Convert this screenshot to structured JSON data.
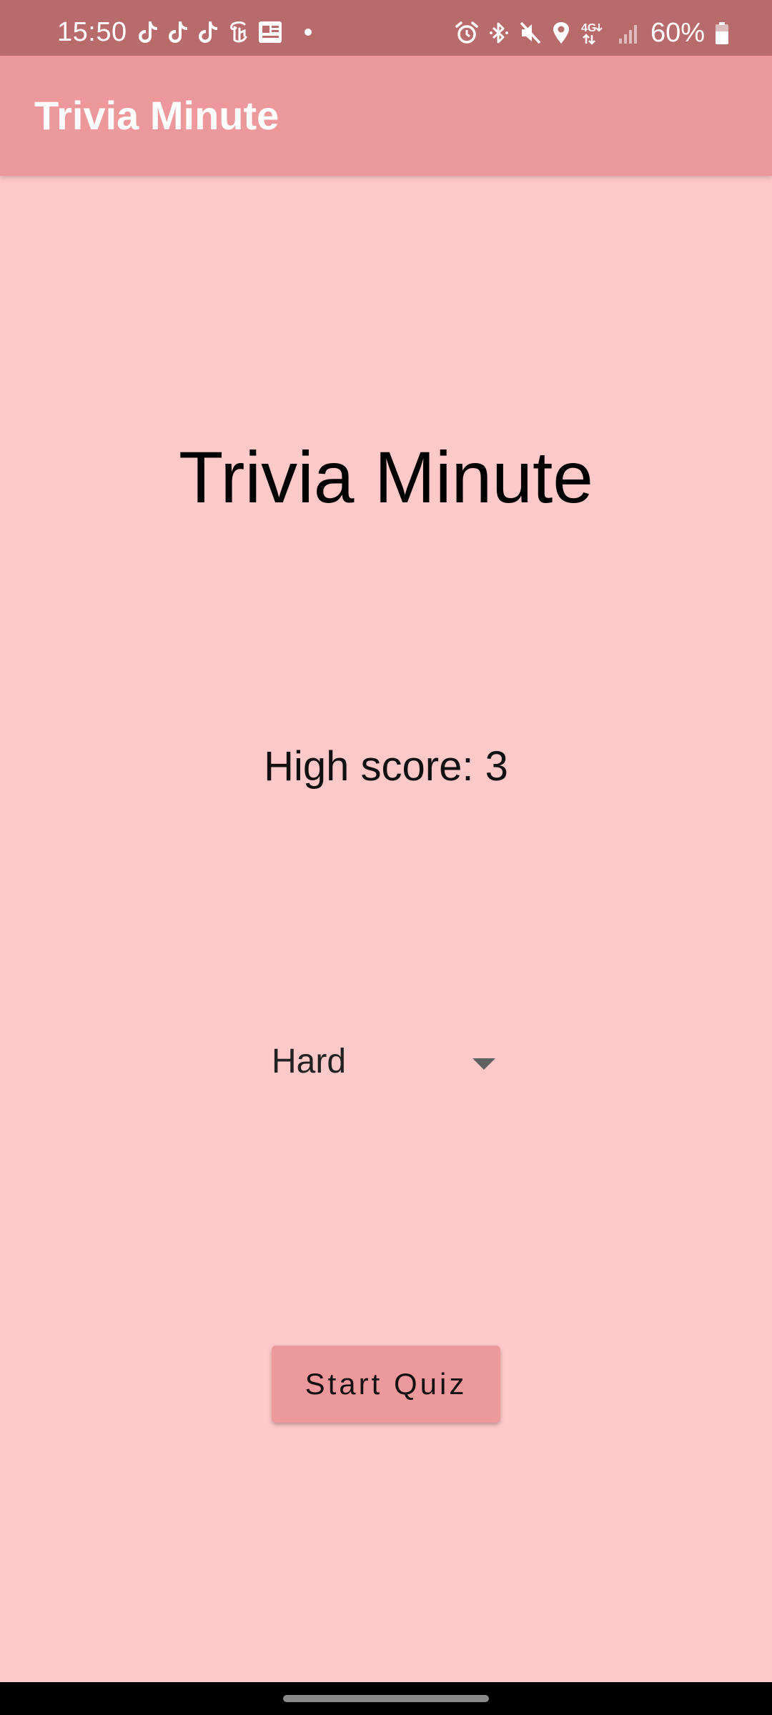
{
  "status_bar": {
    "time": "15:50",
    "battery": "60%",
    "left_icons": [
      "tiktok-icon",
      "tiktok-icon",
      "tiktok-icon",
      "nytimes-icon",
      "news-icon",
      "notification-dot"
    ],
    "right_icons": [
      "alarm-icon",
      "bluetooth-icon",
      "mute-icon",
      "location-icon",
      "4g-lte-icon",
      "signal-icon",
      "battery-icon"
    ]
  },
  "app_bar": {
    "title": "Trivia Minute"
  },
  "main": {
    "title": "Trivia Minute",
    "high_score": "High score: 3",
    "difficulty": {
      "selected": "Hard"
    },
    "start_button_label": "Start Quiz"
  },
  "colors": {
    "status_bar": "#b96b6b",
    "app_bar": "#ed989a",
    "background": "#ffc9c9",
    "button": "#ed989a",
    "nav_bar": "#000000"
  }
}
